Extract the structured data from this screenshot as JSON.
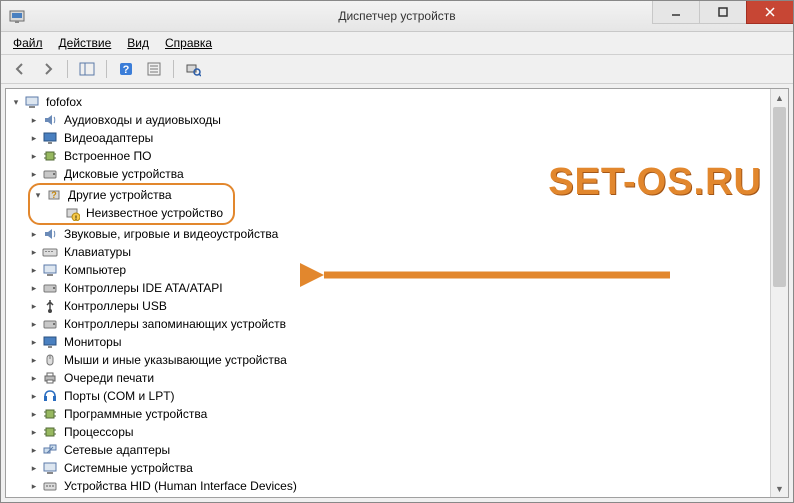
{
  "window": {
    "title": "Диспетчер устройств"
  },
  "menu": {
    "file": "Файл",
    "action": "Действие",
    "view": "Вид",
    "help": "Справка"
  },
  "tree": {
    "root": "fofofox",
    "categories": [
      "Аудиовходы и аудиовыходы",
      "Видеоадаптеры",
      "Встроенное ПО",
      "Дисковые устройства",
      "Другие устройства",
      "Звуковые, игровые и видеоустройства",
      "Клавиатуры",
      "Компьютер",
      "Контроллеры IDE ATA/ATAPI",
      "Контроллеры USB",
      "Контроллеры запоминающих устройств",
      "Мониторы",
      "Мыши и иные указывающие устройства",
      "Очереди печати",
      "Порты (COM и LPT)",
      "Программные устройства",
      "Процессоры",
      "Сетевые адаптеры",
      "Системные устройства",
      "Устройства HID (Human Interface Devices)"
    ],
    "unknown_device": "Неизвестное устройство"
  },
  "watermark": "SET-OS.RU"
}
